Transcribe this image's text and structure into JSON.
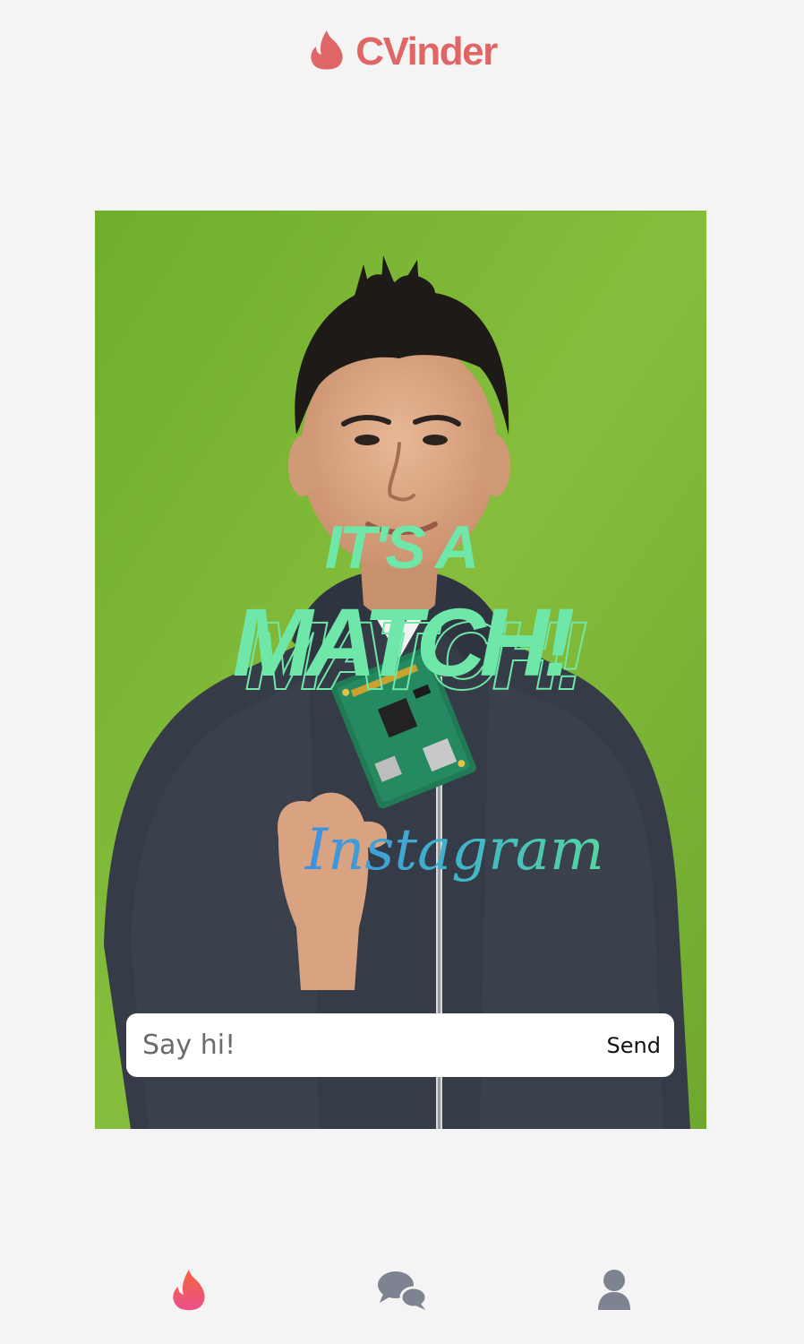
{
  "app": {
    "name": "CVinder",
    "brand_color": "#e06666",
    "match_color": "#6ee7a8"
  },
  "match": {
    "line1": "IT'S A",
    "line2": "MATCH!"
  },
  "photo": {
    "sweater_text": "Instagram"
  },
  "message": {
    "placeholder": "Say hi!",
    "send_label": "Send"
  },
  "nav": {
    "items": [
      {
        "icon": "flame-icon",
        "active": true
      },
      {
        "icon": "chat-bubbles-icon",
        "active": false
      },
      {
        "icon": "person-icon",
        "active": false
      }
    ]
  }
}
